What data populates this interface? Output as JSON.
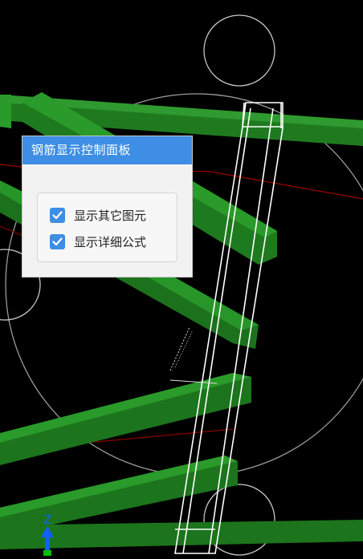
{
  "panel": {
    "title": "钢筋显示控制面板",
    "options": [
      {
        "label": "显示其它图元",
        "checked": true
      },
      {
        "label": "显示详细公式",
        "checked": true
      }
    ]
  },
  "axis": {
    "z_label": "Z"
  },
  "colors": {
    "background": "#000000",
    "panel_header": "#3d8ee4",
    "checkbox": "#3d8ee4",
    "rebar_green": "#1f7a1f",
    "outline_white": "#ffffff",
    "outline_red": "#a00000",
    "axis_blue": "#1060ff"
  },
  "icons": [
    "check-icon",
    "z-axis-arrow-icon"
  ]
}
